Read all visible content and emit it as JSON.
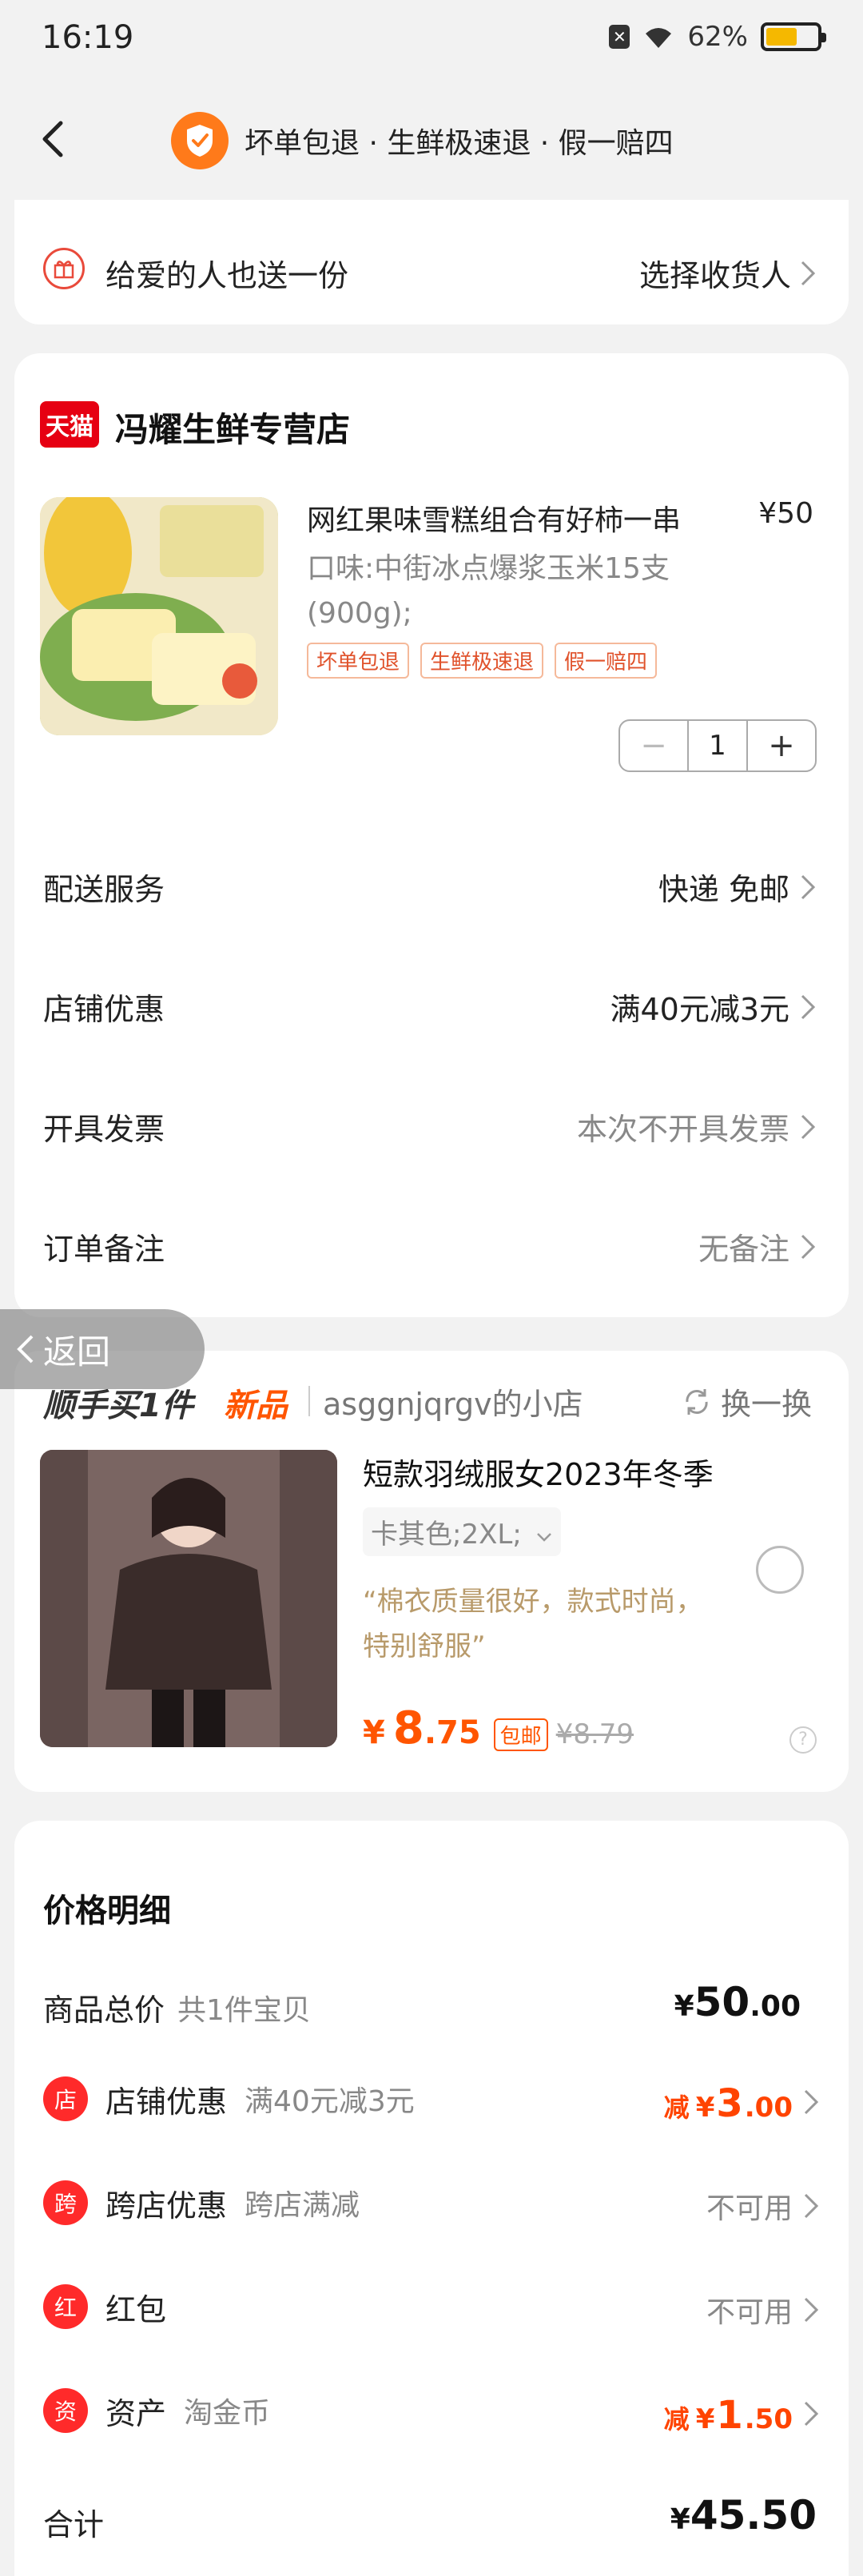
{
  "status": {
    "time": "16:19",
    "battery": "62%"
  },
  "nav": {
    "title": "坏单包退 · 生鲜极速退 · 假一赔四"
  },
  "gift": {
    "label": "给爱的人也送一份",
    "action": "选择收货人"
  },
  "store": {
    "badge": "天猫",
    "name": "冯耀生鲜专营店",
    "product": {
      "title": "网红果味雪糕组合有好柿一串",
      "price": "¥50",
      "spec": "口味:中街冰点爆浆玉米15支(900g);",
      "tags": [
        "坏单包退",
        "生鲜极速退",
        "假一赔四"
      ],
      "quantity": "1",
      "minus": "−",
      "plus": "+"
    },
    "rows": [
      {
        "label": "配送服务",
        "value": "快递 免邮"
      },
      {
        "label": "店铺优惠",
        "value": "满40元减3元"
      },
      {
        "label": "开具发票",
        "value": "本次不开具发票"
      },
      {
        "label": "订单备注",
        "value": "无备注"
      }
    ]
  },
  "back_pill": {
    "label": "返回"
  },
  "recommend": {
    "title": "顺手买1件",
    "new": "新品",
    "shop": "asggnjqrgv的小店",
    "swap": "换一换",
    "name": "短款羽绒服女2023年冬季",
    "spec": "卡其色;2XL;",
    "review": "“棉衣质量很好，款式时尚，特别舒服”",
    "price_symbol": "¥",
    "price_int": "8",
    "price_dec": ".75",
    "baoyou": "包邮",
    "old_price": "¥8.79",
    "help": "?"
  },
  "price_detail": {
    "title": "价格明细",
    "total_label": "商品总价",
    "total_sub": "共1件宝贝",
    "total_sym": "¥",
    "total_int": "50",
    "total_dec": ".00",
    "rows": [
      {
        "label": "店铺优惠",
        "sub": "满40元减3元",
        "prefix": "减",
        "sym": "¥",
        "int": "3",
        "dec": ".00",
        "icon_color": "#ff2a2a",
        "icon_text": "店"
      },
      {
        "label": "跨店优惠",
        "sub": "跨店满减",
        "value": "不可用",
        "icon_color": "#ff2a2a",
        "icon_text": "跨"
      },
      {
        "label": "红包",
        "sub": "",
        "value": "不可用",
        "icon_color": "#ff2a2a",
        "icon_text": "红"
      },
      {
        "label": "资产",
        "sub": "淘金币",
        "prefix": "减",
        "sym": "¥",
        "int": "1",
        "dec": ".50",
        "icon_color": "#ff2a2a",
        "icon_text": "资"
      }
    ],
    "sum_label": "合计",
    "sum_sym": "¥",
    "sum_value": "45.50"
  },
  "colors": {
    "accent": "#ff5500",
    "tmall": "#e60012",
    "background": "#f2f2f2"
  }
}
